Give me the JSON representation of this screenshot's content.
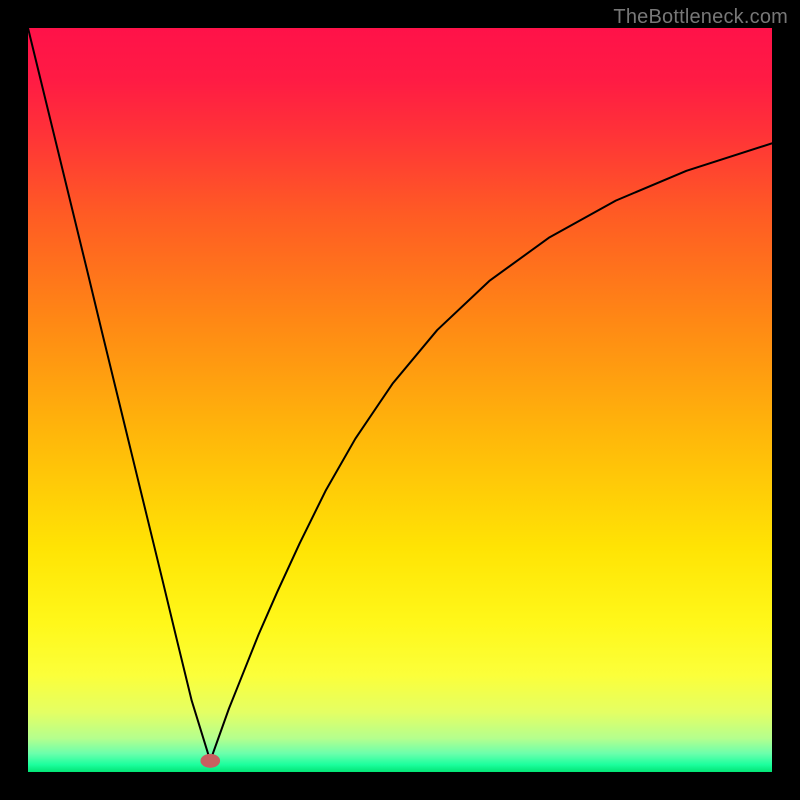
{
  "watermark": "TheBottleneck.com",
  "chart_data": {
    "type": "line",
    "title": "",
    "xlabel": "",
    "ylabel": "",
    "axes_visible": false,
    "grid": false,
    "background_gradient": {
      "stops": [
        {
          "offset": 0.0,
          "color": "#ff1249"
        },
        {
          "offset": 0.07,
          "color": "#ff1b44"
        },
        {
          "offset": 0.14,
          "color": "#ff3238"
        },
        {
          "offset": 0.25,
          "color": "#ff5b24"
        },
        {
          "offset": 0.4,
          "color": "#ff8a14"
        },
        {
          "offset": 0.55,
          "color": "#ffb80a"
        },
        {
          "offset": 0.7,
          "color": "#ffe404"
        },
        {
          "offset": 0.8,
          "color": "#fff81a"
        },
        {
          "offset": 0.87,
          "color": "#fbff3a"
        },
        {
          "offset": 0.92,
          "color": "#e4ff64"
        },
        {
          "offset": 0.955,
          "color": "#b4ff8e"
        },
        {
          "offset": 0.975,
          "color": "#6cffac"
        },
        {
          "offset": 0.99,
          "color": "#1cff9e"
        },
        {
          "offset": 1.0,
          "color": "#02e476"
        }
      ]
    },
    "minimum_marker": {
      "x": 0.245,
      "y": 0.985,
      "radius": 7,
      "color": "#c86060"
    },
    "series": [
      {
        "name": "left-branch",
        "x": [
          0.0,
          0.02,
          0.04,
          0.06,
          0.08,
          0.1,
          0.12,
          0.14,
          0.16,
          0.18,
          0.2,
          0.22,
          0.245
        ],
        "y": [
          0.0,
          0.082,
          0.164,
          0.246,
          0.328,
          0.411,
          0.493,
          0.575,
          0.657,
          0.739,
          0.822,
          0.904,
          0.985
        ],
        "color": "#000000",
        "linewidth": 2
      },
      {
        "name": "right-branch",
        "x": [
          0.245,
          0.255,
          0.27,
          0.29,
          0.31,
          0.335,
          0.365,
          0.4,
          0.44,
          0.49,
          0.55,
          0.62,
          0.7,
          0.79,
          0.885,
          1.0
        ],
        "y": [
          0.985,
          0.957,
          0.915,
          0.865,
          0.815,
          0.758,
          0.693,
          0.622,
          0.552,
          0.478,
          0.406,
          0.34,
          0.282,
          0.232,
          0.192,
          0.155
        ],
        "color": "#000000",
        "linewidth": 2
      }
    ],
    "xlim": [
      0,
      1
    ],
    "ylim": [
      0,
      1
    ]
  }
}
